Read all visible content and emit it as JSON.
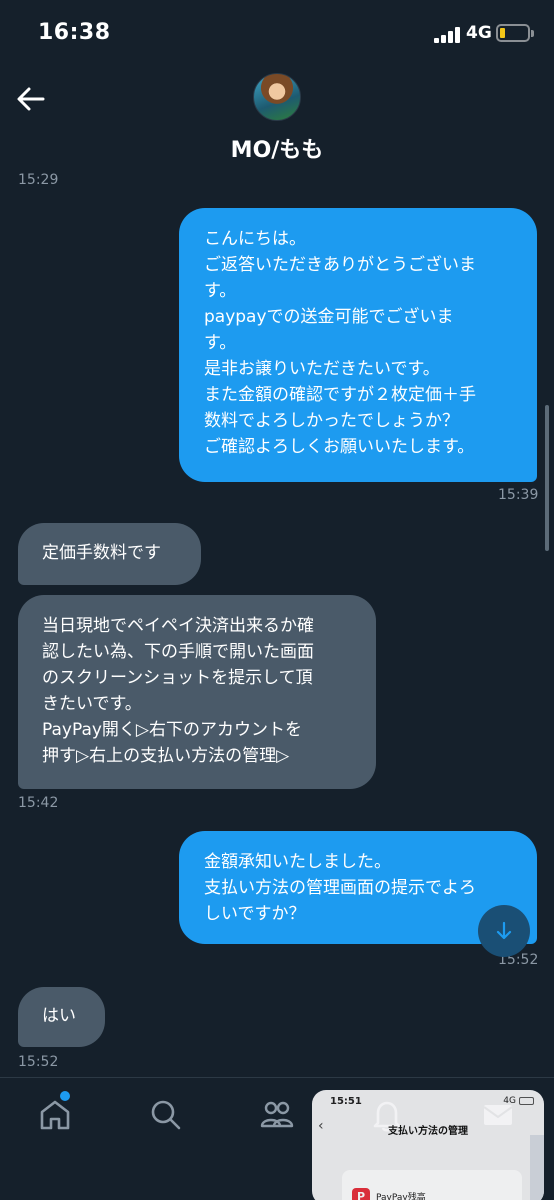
{
  "status_bar": {
    "time": "16:38",
    "network": "4G"
  },
  "header": {
    "display_name": "MO/もも"
  },
  "messages": [
    {
      "time": "15:29"
    },
    {
      "direction": "out",
      "text": "こんにちは。\nご返答いただきありがとうございま\nす。\npaypayでの送金可能でございま\nす。\n是非お譲りいただきたいです。\nまた金額の確認ですが２枚定価＋手\n数料でよろしかったでしょうか？\nご確認よろしくお願いいたします。",
      "time": "15:39"
    },
    {
      "direction": "in",
      "text": "定価手数料です"
    },
    {
      "direction": "in",
      "text": "当日現地でペイペイ決済出来るか確\n認したい為、下の手順で開いた画面\nのスクリーンショットを提示して頂\nきたいです。\nPayPay開く▷右下のアカウントを\n押す▷右上の支払い方法の管理▷",
      "time": "15:42"
    },
    {
      "direction": "out",
      "text": "金額承知いたしました。\n支払い方法の管理画面の提示でよろ\nしいですか？",
      "time": "15:52"
    },
    {
      "direction": "in",
      "text": "はい",
      "time": "15:52"
    }
  ],
  "bottom_nav": {
    "items": [
      "home-icon",
      "search-icon",
      "communities-icon",
      "notifications-icon",
      "messages-icon"
    ],
    "home_has_badge": true
  },
  "pip_overlay": {
    "time": "15:51",
    "network": "4G",
    "title": "支払い方法の管理",
    "card_label": "PayPay残高",
    "logo": "P"
  },
  "colors": {
    "background": "#15202b",
    "outgoing_bubble": "#1d9bf0",
    "incoming_bubble": "#4a5a69",
    "accent": "#1d9bf0"
  }
}
